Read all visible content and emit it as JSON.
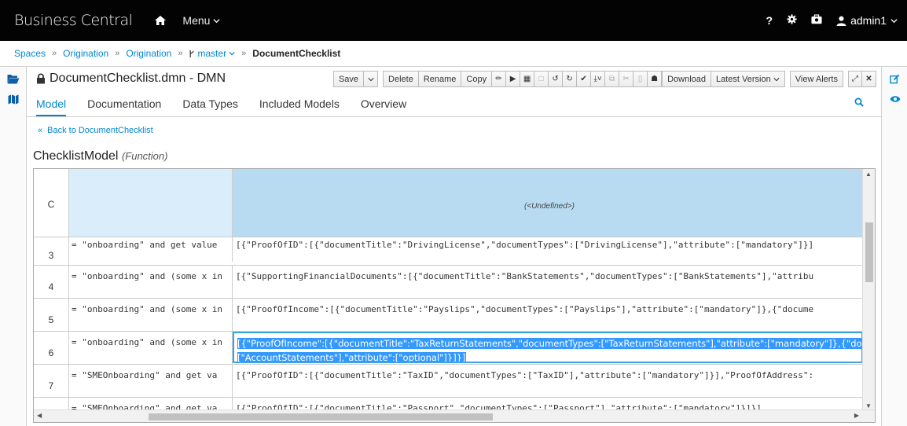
{
  "app": {
    "brand": "Business Central",
    "menu_label": "Menu"
  },
  "topbar": {
    "help": "?",
    "user": "admin1"
  },
  "breadcrumb": {
    "spaces": "Spaces",
    "project1": "Origination",
    "project2": "Origination",
    "branch": "master",
    "asset": "DocumentChecklist"
  },
  "editor": {
    "title": "DocumentChecklist.dmn - DMN",
    "buttons": {
      "save": "Save",
      "delete": "Delete",
      "rename": "Rename",
      "copy": "Copy",
      "download": "Download",
      "latest_version": "Latest Version",
      "view_alerts": "View Alerts"
    }
  },
  "tabs": [
    "Model",
    "Documentation",
    "Data Types",
    "Included Models",
    "Overview"
  ],
  "back_link": "Back to DocumentChecklist",
  "model": {
    "name": "ChecklistModel",
    "kind": "(Function)"
  },
  "grid": {
    "header": {
      "index": "C",
      "output": "(<Undefined>)"
    },
    "rows": [
      {
        "index": "3",
        "input": "= \"onboarding\" and get value",
        "output": "[{\"ProofOfID\":[{\"documentTitle\":\"DrivingLicense\",\"documentTypes\":[\"DrivingLicense\"],\"attribute\":[\"mandatory\"]}]"
      },
      {
        "index": "4",
        "input": "= \"onboarding\" and (some x in",
        "output": "[{\"SupportingFinancialDocuments\":[{\"documentTitle\":\"BankStatements\",\"documentTypes\":[\"BankStatements\"],\"attribu"
      },
      {
        "index": "5",
        "input": "= \"onboarding\" and (some x in",
        "output": "[{\"ProofOfIncome\":[{\"documentTitle\":\"Payslips\",\"documentTypes\":[\"Payslips\"],\"attribute\":[\"mandatory\"]},{\"docume"
      },
      {
        "index": "6",
        "input": "= \"onboarding\" and (some x in",
        "output": "[{\"ProofOfIncome\":[{\"documentTitle\":\"TaxReturnStatements\",\"documentTypes\":[\"TaxReturnStatements\"],\"attribute\":[\"mandatory\"]},{\"document",
        "output_line2": "[\"AccountStatements\"],\"attribute\":[\"optional\"]}]}]"
      },
      {
        "index": "7",
        "input": "= \"SMEOnboarding\" and get va",
        "output": "[{\"ProofOfID\":[{\"documentTitle\":\"TaxID\",\"documentTypes\":[\"TaxID\"],\"attribute\":[\"mandatory\"]}],\"ProofOfAddress\":"
      },
      {
        "index": "8",
        "input": "= \"SMEOnboarding\" and get va",
        "output": "[{\"ProofOfID\":[{\"documentTitle\":\"Passport\",\"documentTypes\":[\"Passport\"],\"attribute\":[\"mandatory\"]}]}]"
      }
    ]
  },
  "colors": {
    "accent": "#0088ce",
    "topbar": "#030303",
    "selection": "#3399ff"
  }
}
